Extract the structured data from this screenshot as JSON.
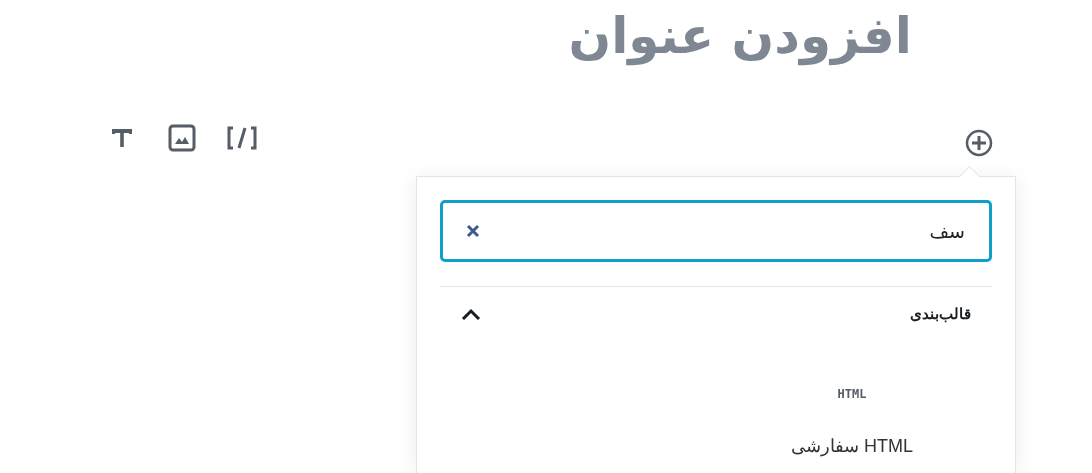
{
  "title": {
    "placeholder": "افزودن عنوان"
  },
  "inserter": {
    "search": {
      "value": "سف"
    },
    "sections": [
      {
        "title": "قالب‌بندی",
        "expanded": true,
        "items": [
          {
            "icon_text": "HTML",
            "label": "HTML سفارشی"
          }
        ]
      }
    ]
  }
}
